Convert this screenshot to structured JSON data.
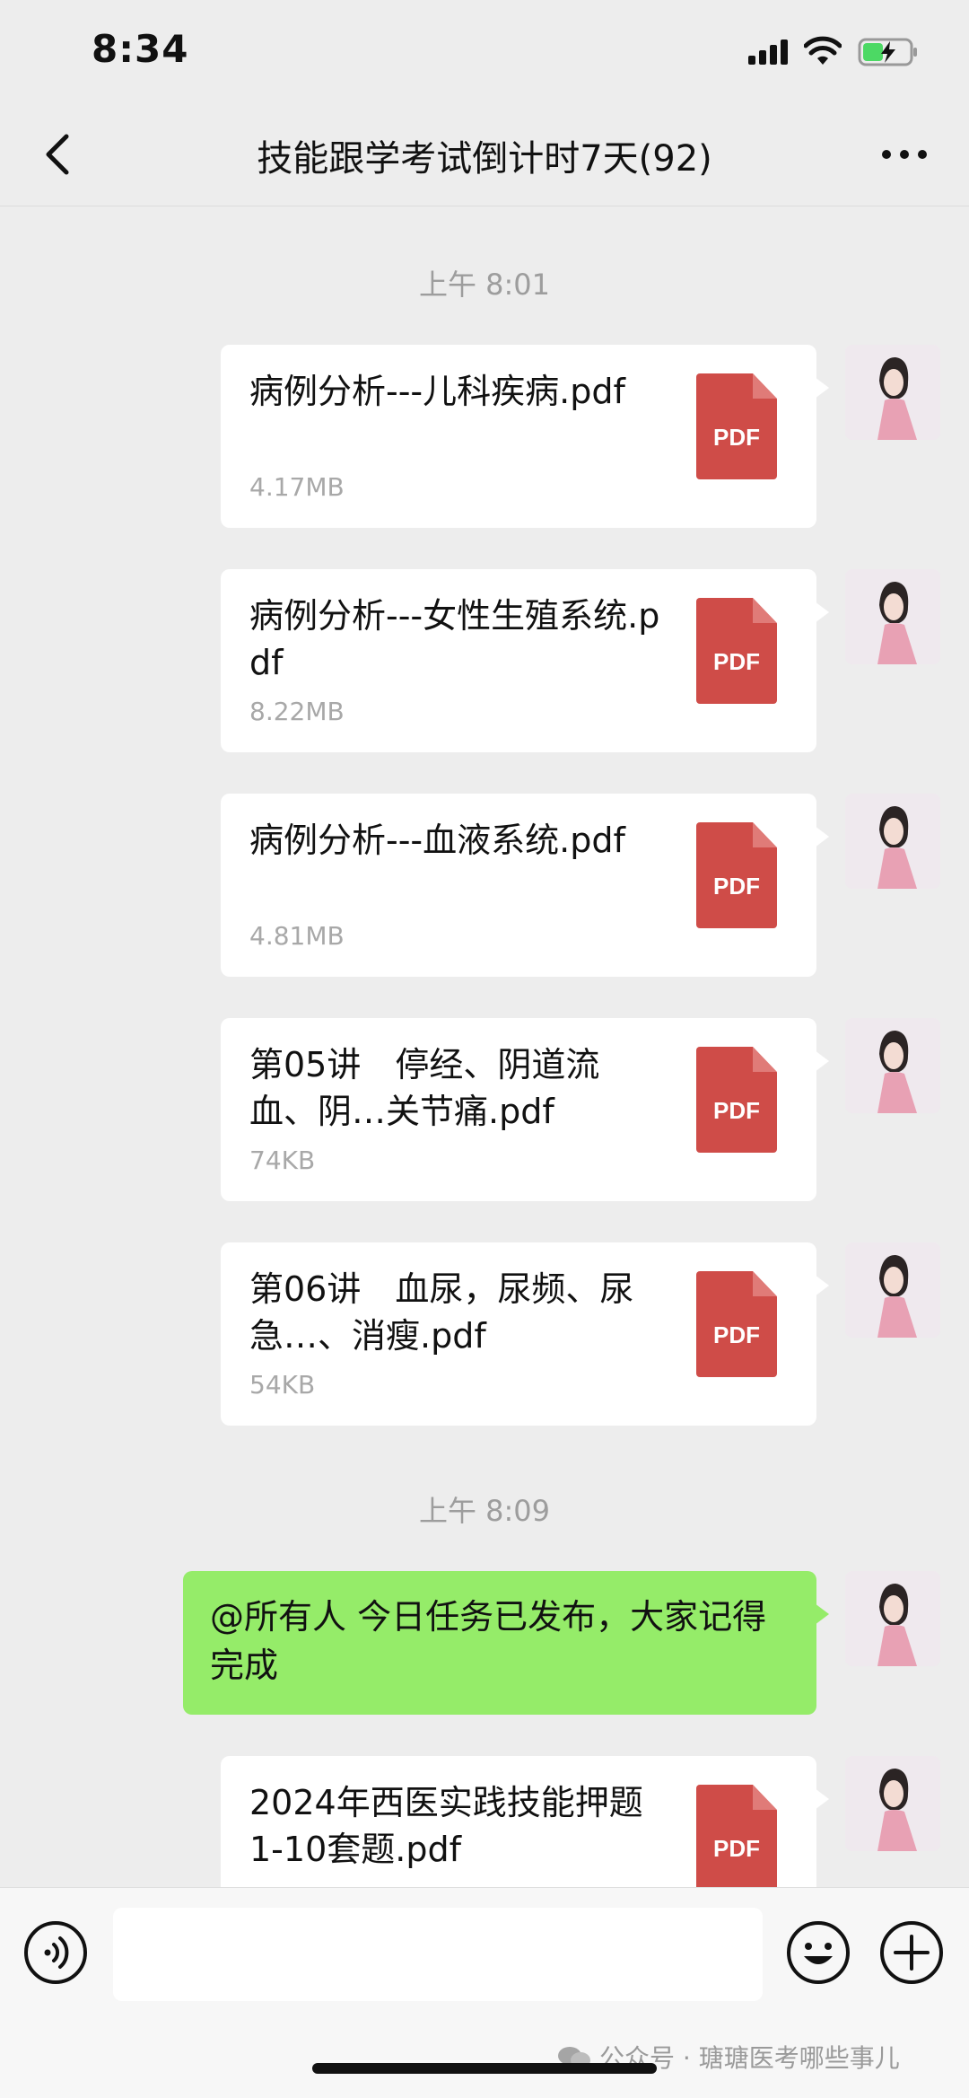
{
  "status_bar": {
    "time": "8:34"
  },
  "nav": {
    "title": "技能跟学考试倒计时7天(92)"
  },
  "timestamps": [
    "上午 8:01",
    "上午 8:09"
  ],
  "files": [
    {
      "name": "病例分析---儿科疾病.pdf",
      "size": "4.17MB",
      "icon_label": "PDF"
    },
    {
      "name": "病例分析---女性生殖系统.pdf",
      "size": "8.22MB",
      "icon_label": "PDF"
    },
    {
      "name": "病例分析---血液系统.pdf",
      "size": "4.81MB",
      "icon_label": "PDF"
    },
    {
      "name": "第05讲　停经、阴道流血、阴…关节痛.pdf",
      "size": "74KB",
      "icon_label": "PDF"
    },
    {
      "name": "第06讲　血尿，尿频、尿急…、消瘦.pdf",
      "size": "54KB",
      "icon_label": "PDF"
    },
    {
      "name": "2024年西医实践技能押题1-10套题.pdf",
      "size": "",
      "icon_label": "PDF"
    }
  ],
  "text_message": "@所有人 今日任务已发布，大家记得完成",
  "input": {
    "placeholder": ""
  },
  "watermark": "公众号 · 瑭瑭医考哪些事儿",
  "colors": {
    "background": "#ededed",
    "bubble_self": "#95ec69",
    "pdf_icon": "#cf4c48"
  }
}
